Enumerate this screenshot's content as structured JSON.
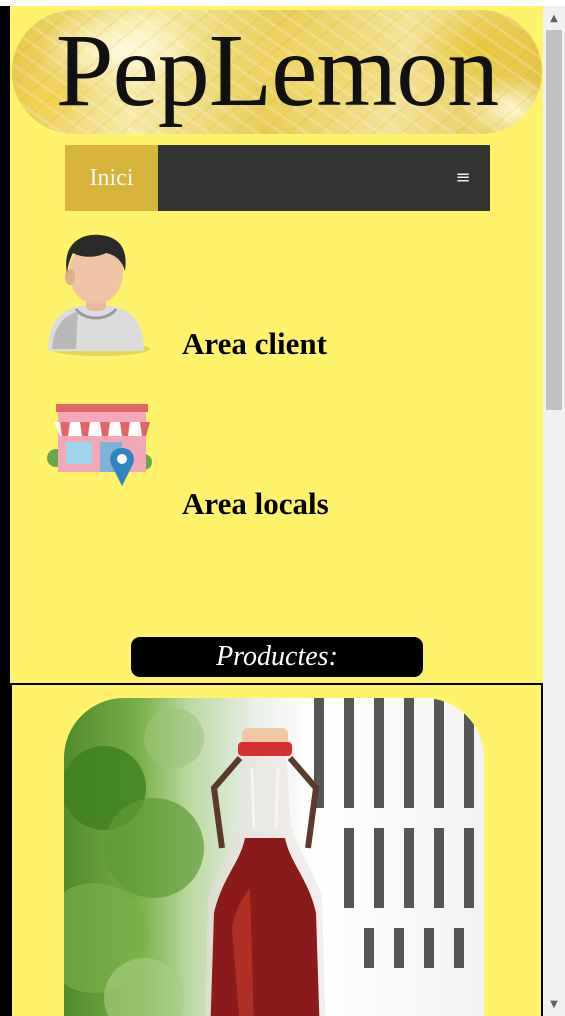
{
  "header": {
    "brand": "PepLemon"
  },
  "nav": {
    "home_label": "Inici",
    "menu_icon": "hamburger-icon",
    "menu_glyph": "≡"
  },
  "areas": [
    {
      "label": "Area client",
      "icon": "user-avatar-icon"
    },
    {
      "label": "Area locals",
      "icon": "store-location-icon"
    }
  ],
  "products": {
    "heading": "Productes:"
  },
  "colors": {
    "page_bg": "#fff36b",
    "nav_bg": "#333333",
    "nav_active": "#d6b53a",
    "products_bar": "#000000"
  },
  "scrollbar": {
    "up_glyph": "▲",
    "down_glyph": "▼"
  }
}
